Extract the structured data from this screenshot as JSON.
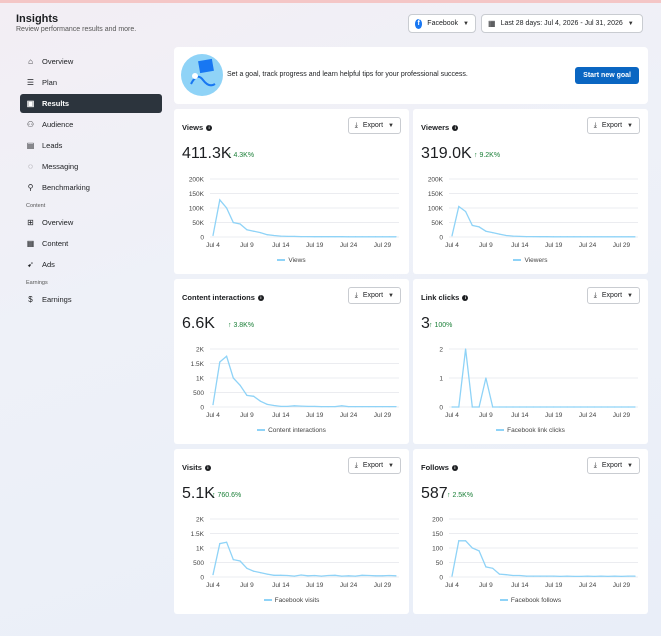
{
  "header": {
    "title": "Insights",
    "subtitle": "Review performance results and more."
  },
  "filters": {
    "platform": "Facebook",
    "date_range": "Last 28 days: Jul 4, 2026 - Jul 31, 2026"
  },
  "sidebar": {
    "items": [
      {
        "label": "Overview",
        "icon": "home-icon"
      },
      {
        "label": "Plan",
        "icon": "list-icon"
      },
      {
        "label": "Results",
        "icon": "results-icon",
        "active": true
      },
      {
        "label": "Audience",
        "icon": "audience-icon"
      },
      {
        "label": "Leads",
        "icon": "leads-icon"
      },
      {
        "label": "Messaging",
        "icon": "messaging-icon"
      },
      {
        "label": "Benchmarking",
        "icon": "benchmark-icon"
      }
    ],
    "content_section": "Content",
    "content_items": [
      {
        "label": "Overview",
        "icon": "grid-icon"
      },
      {
        "label": "Content",
        "icon": "table-icon"
      },
      {
        "label": "Ads",
        "icon": "megaphone-icon"
      }
    ],
    "earnings_section": "Earnings",
    "earnings_items": [
      {
        "label": "Earnings",
        "icon": "dollar-icon"
      }
    ]
  },
  "banner": {
    "text": "Set a goal, track progress and learn helpful tips for your professional success.",
    "button": "Start new goal"
  },
  "export_label": "Export",
  "colors": {
    "line": "#8fd3f7",
    "accent": "#0a66c2",
    "positive": "#1a7f37",
    "active_nav": "#2c343d"
  },
  "chart_data": [
    {
      "type": "line",
      "title": "Views",
      "total": "411.3K",
      "change": "4.3K%",
      "legend": "Views",
      "yticks": [
        "200K",
        "150K",
        "100K",
        "50K",
        "0"
      ],
      "ylim": [
        0,
        200000
      ],
      "xticks": [
        "Jul 4",
        "Jul 9",
        "Jul 14",
        "Jul 19",
        "Jul 24",
        "Jul 29"
      ],
      "x": [
        "Jul 4",
        "Jul 5",
        "Jul 6",
        "Jul 7",
        "Jul 8",
        "Jul 9",
        "Jul 10",
        "Jul 11",
        "Jul 12",
        "Jul 13",
        "Jul 14",
        "Jul 15",
        "Jul 16",
        "Jul 17",
        "Jul 18",
        "Jul 19",
        "Jul 20",
        "Jul 21",
        "Jul 22",
        "Jul 23",
        "Jul 24",
        "Jul 25",
        "Jul 26",
        "Jul 27",
        "Jul 28",
        "Jul 29",
        "Jul 30",
        "Jul 31"
      ],
      "values": [
        5000,
        128000,
        100000,
        50000,
        45000,
        25000,
        20000,
        15000,
        8000,
        5000,
        3000,
        2000,
        2000,
        1500,
        1500,
        1000,
        1000,
        1000,
        1000,
        1000,
        800,
        800,
        800,
        800,
        800,
        800,
        800,
        800
      ]
    },
    {
      "type": "line",
      "title": "Viewers",
      "total": "319.0K",
      "change": "9.2K%",
      "legend": "Viewers",
      "yticks": [
        "200K",
        "150K",
        "100K",
        "50K",
        "0"
      ],
      "ylim": [
        0,
        200000
      ],
      "xticks": [
        "Jul 4",
        "Jul 9",
        "Jul 14",
        "Jul 19",
        "Jul 24",
        "Jul 29"
      ],
      "x": [
        "Jul 4",
        "Jul 5",
        "Jul 6",
        "Jul 7",
        "Jul 8",
        "Jul 9",
        "Jul 10",
        "Jul 11",
        "Jul 12",
        "Jul 13",
        "Jul 14",
        "Jul 15",
        "Jul 16",
        "Jul 17",
        "Jul 18",
        "Jul 19",
        "Jul 20",
        "Jul 21",
        "Jul 22",
        "Jul 23",
        "Jul 24",
        "Jul 25",
        "Jul 26",
        "Jul 27",
        "Jul 28",
        "Jul 29",
        "Jul 30",
        "Jul 31"
      ],
      "values": [
        4000,
        105000,
        88000,
        40000,
        35000,
        20000,
        15000,
        10000,
        5000,
        3000,
        2000,
        1500,
        1500,
        1000,
        1000,
        800,
        800,
        800,
        800,
        800,
        600,
        600,
        600,
        600,
        600,
        600,
        600,
        600
      ]
    },
    {
      "type": "line",
      "title": "Content interactions",
      "total": "6.6K",
      "change": "3.8K%",
      "legend": "Content interactions",
      "yticks": [
        "2K",
        "1.5K",
        "1K",
        "500",
        "0"
      ],
      "ylim": [
        0,
        2000
      ],
      "xticks": [
        "Jul 4",
        "Jul 9",
        "Jul 14",
        "Jul 19",
        "Jul 24",
        "Jul 29"
      ],
      "x": [
        "Jul 4",
        "Jul 5",
        "Jul 6",
        "Jul 7",
        "Jul 8",
        "Jul 9",
        "Jul 10",
        "Jul 11",
        "Jul 12",
        "Jul 13",
        "Jul 14",
        "Jul 15",
        "Jul 16",
        "Jul 17",
        "Jul 18",
        "Jul 19",
        "Jul 20",
        "Jul 21",
        "Jul 22",
        "Jul 23",
        "Jul 24",
        "Jul 25",
        "Jul 26",
        "Jul 27",
        "Jul 28",
        "Jul 29",
        "Jul 30",
        "Jul 31"
      ],
      "values": [
        80,
        1550,
        1750,
        1000,
        750,
        400,
        370,
        200,
        90,
        50,
        20,
        20,
        40,
        30,
        20,
        20,
        15,
        15,
        15,
        40,
        15,
        15,
        15,
        15,
        15,
        15,
        15,
        15
      ]
    },
    {
      "type": "line",
      "title": "Link clicks",
      "total": "3",
      "change": "100%",
      "legend": "Facebook link clicks",
      "yticks": [
        "2",
        "1",
        "0"
      ],
      "ylim": [
        0,
        2
      ],
      "xticks": [
        "Jul 4",
        "Jul 9",
        "Jul 14",
        "Jul 19",
        "Jul 24",
        "Jul 29"
      ],
      "x": [
        "Jul 4",
        "Jul 5",
        "Jul 6",
        "Jul 7",
        "Jul 8",
        "Jul 9",
        "Jul 10",
        "Jul 11",
        "Jul 12",
        "Jul 13",
        "Jul 14",
        "Jul 15",
        "Jul 16",
        "Jul 17",
        "Jul 18",
        "Jul 19",
        "Jul 20",
        "Jul 21",
        "Jul 22",
        "Jul 23",
        "Jul 24",
        "Jul 25",
        "Jul 26",
        "Jul 27",
        "Jul 28",
        "Jul 29",
        "Jul 30",
        "Jul 31"
      ],
      "values": [
        0,
        0,
        2,
        0,
        0,
        1,
        0,
        0,
        0,
        0,
        0,
        0,
        0,
        0,
        0,
        0,
        0,
        0,
        0,
        0,
        0,
        0,
        0,
        0,
        0,
        0,
        0,
        0
      ]
    },
    {
      "type": "line",
      "title": "Visits",
      "total": "5.1K",
      "change": "760.6%",
      "legend": "Facebook visits",
      "yticks": [
        "2K",
        "1.5K",
        "1K",
        "500",
        "0"
      ],
      "ylim": [
        0,
        2000
      ],
      "xticks": [
        "Jul 4",
        "Jul 9",
        "Jul 14",
        "Jul 19",
        "Jul 24",
        "Jul 29"
      ],
      "x": [
        "Jul 4",
        "Jul 5",
        "Jul 6",
        "Jul 7",
        "Jul 8",
        "Jul 9",
        "Jul 10",
        "Jul 11",
        "Jul 12",
        "Jul 13",
        "Jul 14",
        "Jul 15",
        "Jul 16",
        "Jul 17",
        "Jul 18",
        "Jul 19",
        "Jul 20",
        "Jul 21",
        "Jul 22",
        "Jul 23",
        "Jul 24",
        "Jul 25",
        "Jul 26",
        "Jul 27",
        "Jul 28",
        "Jul 29",
        "Jul 30",
        "Jul 31"
      ],
      "values": [
        80,
        1150,
        1200,
        600,
        550,
        300,
        200,
        150,
        100,
        60,
        60,
        50,
        30,
        70,
        40,
        50,
        30,
        50,
        60,
        30,
        40,
        30,
        60,
        50,
        40,
        40,
        50,
        40
      ]
    },
    {
      "type": "line",
      "title": "Follows",
      "total": "587",
      "change": "2.5K%",
      "legend": "Facebook follows",
      "yticks": [
        "200",
        "150",
        "100",
        "50",
        "0"
      ],
      "ylim": [
        0,
        200
      ],
      "xticks": [
        "Jul 4",
        "Jul 9",
        "Jul 14",
        "Jul 19",
        "Jul 24",
        "Jul 29"
      ],
      "x": [
        "Jul 4",
        "Jul 5",
        "Jul 6",
        "Jul 7",
        "Jul 8",
        "Jul 9",
        "Jul 10",
        "Jul 11",
        "Jul 12",
        "Jul 13",
        "Jul 14",
        "Jul 15",
        "Jul 16",
        "Jul 17",
        "Jul 18",
        "Jul 19",
        "Jul 20",
        "Jul 21",
        "Jul 22",
        "Jul 23",
        "Jul 24",
        "Jul 25",
        "Jul 26",
        "Jul 27",
        "Jul 28",
        "Jul 29",
        "Jul 30",
        "Jul 31"
      ],
      "values": [
        3,
        125,
        125,
        100,
        90,
        35,
        30,
        10,
        8,
        5,
        5,
        3,
        3,
        3,
        3,
        3,
        2,
        3,
        2,
        2,
        3,
        2,
        3,
        2,
        3,
        2,
        3,
        3
      ]
    }
  ]
}
